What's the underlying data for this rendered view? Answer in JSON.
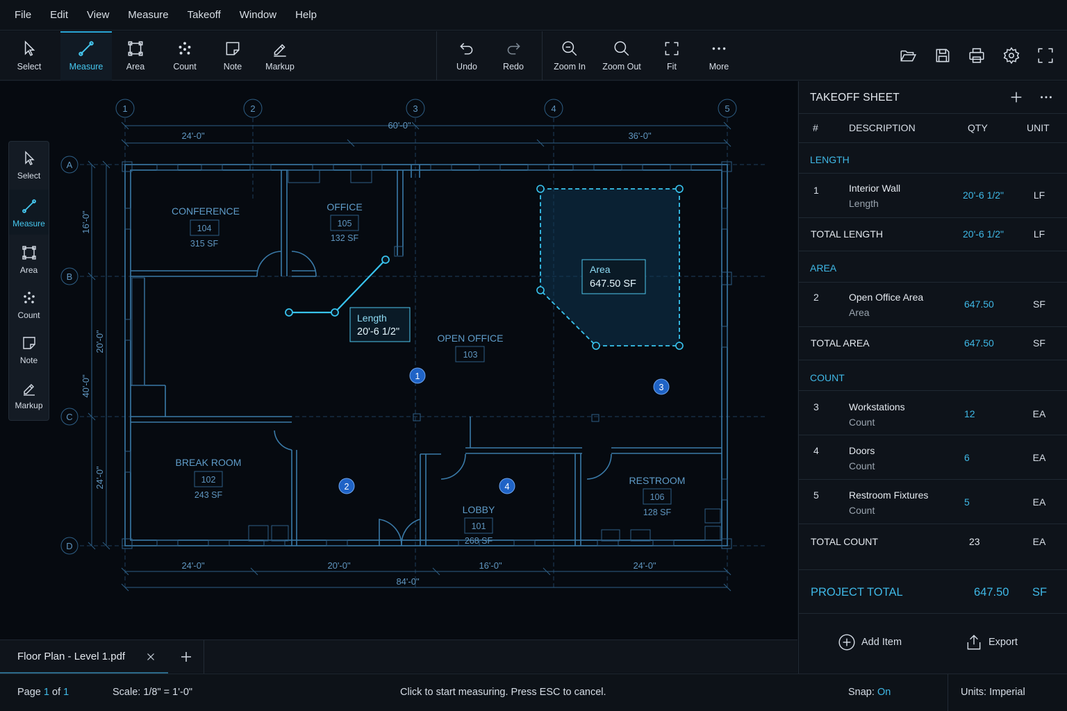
{
  "menu": [
    "File",
    "Edit",
    "View",
    "Measure",
    "Takeoff",
    "Window",
    "Help"
  ],
  "toolbar": {
    "select": "Select",
    "measure": "Measure",
    "area": "Area",
    "count": "Count",
    "note": "Note",
    "markup": "Markup",
    "undo": "Undo",
    "redo": "Redo",
    "zoom_in": "Zoom In",
    "zoom_out": "Zoom Out",
    "fit": "Fit",
    "more": "More"
  },
  "left_tools": {
    "select": "Select",
    "measure": "Measure",
    "area": "Area",
    "count": "Count",
    "note": "Note",
    "markup": "Markup"
  },
  "drawing": {
    "grid_columns": [
      "1",
      "2",
      "3",
      "4",
      "5"
    ],
    "grid_rows": [
      "A",
      "B",
      "C",
      "D"
    ],
    "dims_top": {
      "overall": "60'-0\"",
      "left": "24'-0\"",
      "right": "36'-0\""
    },
    "dims_bottom": {
      "a": "24'-0\"",
      "b": "20'-0\"",
      "c": "16'-0\"",
      "d": "24'-0\"",
      "overall": "84'-0\""
    },
    "dims_left": {
      "a": "16'-0\"",
      "b": "20'-0\"",
      "c": "24'-0\"",
      "overall": "40'-0\""
    },
    "rooms": {
      "conference": {
        "name": "CONFERENCE",
        "number": "104",
        "area": "315 SF"
      },
      "office": {
        "name": "OFFICE",
        "number": "105",
        "area": "132 SF"
      },
      "open_office": {
        "name": "OPEN OFFICE",
        "number": "103"
      },
      "break_room": {
        "name": "BREAK ROOM",
        "number": "102",
        "area": "243 SF"
      },
      "lobby": {
        "name": "LOBBY",
        "number": "101",
        "area": "268 SF"
      },
      "restroom": {
        "name": "RESTROOM",
        "number": "106",
        "area": "128 SF"
      }
    },
    "length_callout": {
      "label": "Length",
      "value": "20'-6 1/2\""
    },
    "area_callout": {
      "label": "Area",
      "value": "647.50 SF"
    },
    "count_markers": [
      "1",
      "2",
      "3",
      "4"
    ]
  },
  "doc_tab": {
    "name": "Floor Plan - Level 1.pdf"
  },
  "status": {
    "page_prefix": "Page",
    "page_current": "1",
    "page_of": "of",
    "page_total": "1",
    "scale_label": "Scale:",
    "scale_value": "1/8\" = 1'-0\"",
    "hint": "Click to start measuring. Press ESC to cancel.",
    "snap_label": "Snap:",
    "snap_value": "On",
    "units_label": "Units:",
    "units_value": "Imperial"
  },
  "takeoff": {
    "title": "TAKEOFF SHEET",
    "columns": {
      "num": "#",
      "desc": "DESCRIPTION",
      "qty": "QTY",
      "unit": "UNIT"
    },
    "length_section": "LENGTH",
    "area_section": "AREA",
    "count_section": "COUNT",
    "items": [
      {
        "num": "1",
        "desc": "Interior Wall",
        "type": "Length",
        "qty": "20'-6 1/2\"",
        "unit": "LF"
      },
      {
        "num": "2",
        "desc": "Open Office Area",
        "type": "Area",
        "qty": "647.50",
        "unit": "SF"
      },
      {
        "num": "3",
        "desc": "Workstations",
        "type": "Count",
        "qty": "12",
        "unit": "EA"
      },
      {
        "num": "4",
        "desc": "Doors",
        "type": "Count",
        "qty": "6",
        "unit": "EA"
      },
      {
        "num": "5",
        "desc": "Restroom Fixtures",
        "type": "Count",
        "qty": "5",
        "unit": "EA"
      }
    ],
    "total_length": {
      "label": "TOTAL LENGTH",
      "qty": "20'-6 1/2\"",
      "unit": "LF"
    },
    "total_area": {
      "label": "TOTAL AREA",
      "qty": "647.50",
      "unit": "SF"
    },
    "total_count": {
      "label": "TOTAL COUNT",
      "qty": "23",
      "unit": "EA"
    },
    "project_total": {
      "label": "PROJECT TOTAL",
      "qty": "647.50",
      "unit": "SF"
    },
    "add_item": "Add Item",
    "export": "Export"
  },
  "colors": {
    "accent": "#3fb8e6",
    "background": "#0b1017",
    "blueprint": "#3a7aa8",
    "marker": "#1f63c6"
  }
}
